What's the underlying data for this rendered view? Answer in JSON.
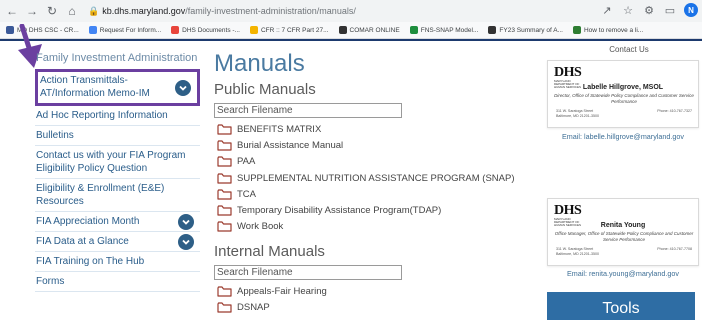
{
  "browser": {
    "url_host": "kb.dhs.maryland.gov",
    "url_path": "/family-investment-administration/manuals/",
    "bookmarks": [
      {
        "label": "MD DHS CSC - CR...",
        "color": "#3b5998"
      },
      {
        "label": "Request For Inform...",
        "color": "#4285f4"
      },
      {
        "label": "DHS Documents -...",
        "color": "#e8453c"
      },
      {
        "label": "CFR :: 7 CFR Part 27...",
        "color": "#f4b400"
      },
      {
        "label": "COMAR ONLINE",
        "color": "#333333"
      },
      {
        "label": "FNS-SNAP Model...",
        "color": "#1e8e3e"
      },
      {
        "label": "FY23 Summary of A...",
        "color": "#333333"
      },
      {
        "label": "How to remove a li...",
        "color": "#2e7d32"
      }
    ],
    "profile_initial": "N",
    "icons": [
      "back-icon",
      "forward-icon",
      "reload-icon",
      "home-icon",
      "lock-icon",
      "share-icon",
      "star-icon",
      "extensions-icon",
      "sidebar-icon"
    ]
  },
  "sidebar": {
    "title": "Family Investment Administration",
    "items": [
      {
        "label": "Action Transmittals-AT/Information Memo-IM"
      },
      {
        "label": "Ad Hoc Reporting Information"
      },
      {
        "label": "Bulletins"
      },
      {
        "label": "Contact us with your FIA Program Eligibility Policy Question"
      },
      {
        "label": "Eligibility & Enrollment (E&E) Resources"
      },
      {
        "label": "FIA Appreciation Month"
      },
      {
        "label": "FIA Data at a Glance"
      },
      {
        "label": "FIA Training on The Hub"
      },
      {
        "label": "Forms"
      }
    ]
  },
  "main": {
    "title": "Manuals",
    "public_heading": "Public Manuals",
    "search_placeholder": "Search Filename",
    "public_folders": [
      "BENEFITS MATRIX",
      "Burial Assistance Manual",
      "PAA",
      "SUPPLEMENTAL NUTRITION ASSISTANCE PROGRAM (SNAP)",
      "TCA",
      "Temporary Disability Assistance Program(TDAP)",
      "Work Book"
    ],
    "internal_heading": "Internal Manuals",
    "internal_search_placeholder": "Search Filename",
    "internal_folders": [
      "Appeals-Fair Hearing",
      "DSNAP"
    ]
  },
  "contact": {
    "title": "Contact Us",
    "logo_text": "DHS",
    "logo_subtext": "MARYLAND DEPARTMENT OF HUMAN SERVICES",
    "cards": [
      {
        "name": "Labelle Hillgrove, MSOL",
        "role": "Director, Office of Statewide Policy Compliance and Customer Service Performance",
        "address_line1": "311 W. Saratoga Street",
        "address_line2": "Baltimore, MD 21201-3500",
        "phone": "Phone: 410-767-7327",
        "email": "Email: labelle.hillgrove@maryland.gov"
      },
      {
        "name": "Renita Young",
        "role": "Office Manager, Office of Statewide Policy Compliance and Customer Service Performance",
        "address_line1": "311 W. Saratoga Street",
        "address_line2": "Baltimore, MD 21201-3500",
        "phone": "Phone: 410-767-7708",
        "email": "Email: renita.young@maryland.gov"
      }
    ]
  },
  "tools": {
    "label": "Tools"
  },
  "colors": {
    "accent": "#2e6da4",
    "sidebar_link": "#2a5d8a",
    "highlight_box": "#6b3fa0",
    "heading": "#4a7aa1"
  }
}
